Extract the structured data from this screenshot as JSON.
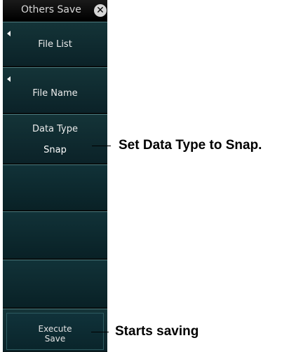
{
  "panel": {
    "title": "Others Save",
    "close_icon": "close-icon",
    "softkeys": {
      "file_list": {
        "label": "File List",
        "icon": "left-arrow-icon"
      },
      "file_name": {
        "label": "File Name",
        "icon": "left-arrow-icon"
      },
      "data_type": {
        "label": "Data Type",
        "value": "Snap"
      },
      "execute": {
        "line1": "Execute",
        "line2": "Save"
      }
    }
  },
  "annotations": {
    "data_type_note": "Set Data Type to Snap.",
    "execute_note": "Starts saving"
  },
  "colors": {
    "panel_bg": "#000000",
    "softkey_bg": "#133338",
    "softkey_border": "#4d7c80",
    "text": "#ececec"
  }
}
